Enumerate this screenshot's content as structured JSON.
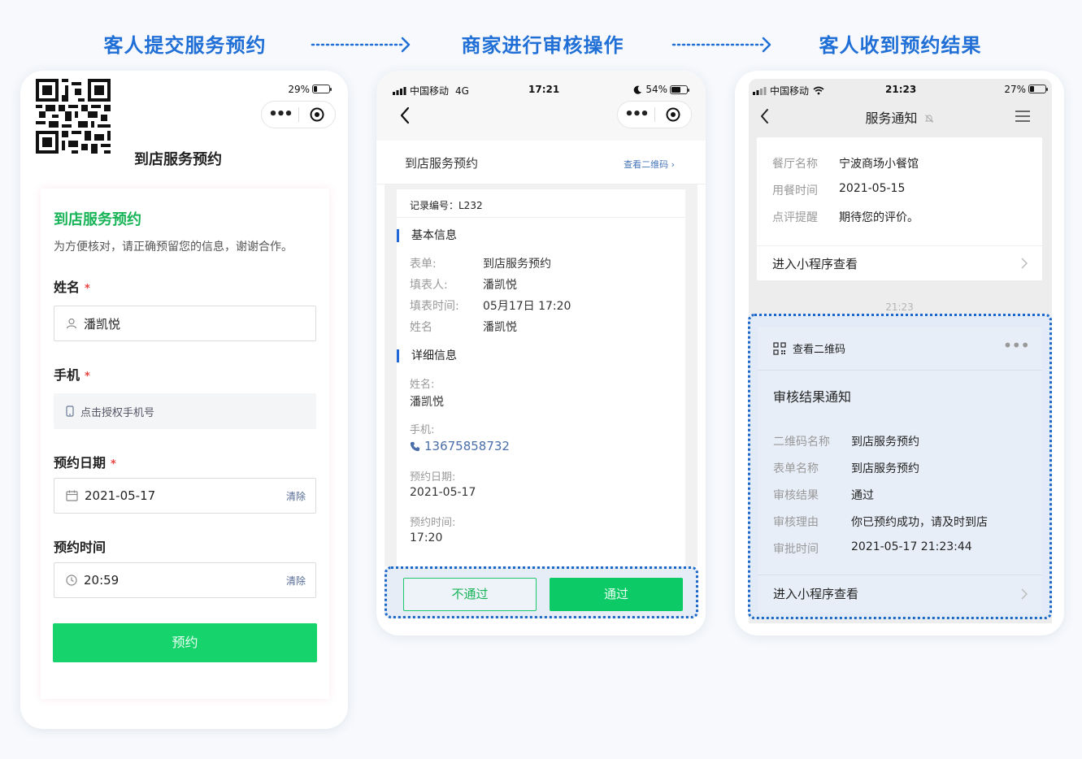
{
  "steps": {
    "step1": "客人提交服务预约",
    "step2": "商家进行审核操作",
    "step3": "客人收到预约结果"
  },
  "phone1": {
    "battery": "29%",
    "page_title": "到店服务预约",
    "form_title": "到店服务预约",
    "form_desc": "为方便核对，请正确预留您的信息，谢谢合作。",
    "name_label": "姓名",
    "name_value": "潘凯悦",
    "mobile_label": "手机",
    "mobile_placeholder": "点击授权手机号",
    "date_label": "预约日期",
    "date_value": "2021-05-17",
    "time_label": "预约时间",
    "time_value": "20:59",
    "clear_label": "清除",
    "required_mark": "*",
    "submit_label": "预约"
  },
  "phone2": {
    "carrier": "中国移动",
    "network": "4G",
    "time": "17:21",
    "battery": "54%",
    "header_title": "到店服务预约",
    "qr_link": "查看二维码",
    "record_no": "记录编号：L232",
    "basic_title": "基本信息",
    "basic": [
      {
        "k": "表单:",
        "v": "到店服务预约"
      },
      {
        "k": "填表人:",
        "v": "潘凯悦"
      },
      {
        "k": "填表时间:",
        "v": "05月17日 17:20"
      },
      {
        "k": "姓名",
        "v": "潘凯悦"
      }
    ],
    "detail_title": "详细信息",
    "details": [
      {
        "k": "姓名:",
        "v": "潘凯悦"
      },
      {
        "k": "手机:",
        "v": "13675858732"
      },
      {
        "k": "预约日期:",
        "v": "2021-05-17"
      },
      {
        "k": "预约时间:",
        "v": "17:20"
      }
    ],
    "reject_label": "不通过",
    "pass_label": "通过"
  },
  "phone3": {
    "carrier": "中国移动",
    "time": "21:23",
    "battery": "27%",
    "title": "服务通知",
    "notice1": [
      {
        "k": "餐厅名称",
        "v": "宁波商场小餐馆"
      },
      {
        "k": "用餐时间",
        "v": "2021-05-15"
      },
      {
        "k": "点评提醒",
        "v": "期待您的评价。"
      }
    ],
    "enter_label": "进入小程序查看",
    "timestamp": "21:23",
    "qr_head": "查看二维码",
    "result_title": "审核结果通知",
    "notice2": [
      {
        "k": "二维码名称",
        "v": "到店服务预约"
      },
      {
        "k": "表单名称",
        "v": "到店服务预约"
      },
      {
        "k": "审核结果",
        "v": "通过"
      },
      {
        "k": "审核理由",
        "v": "你已预约成功，请及时到店"
      },
      {
        "k": "审批时间",
        "v": "2021-05-17 21:23:44"
      }
    ],
    "enter_label2": "进入小程序查看"
  },
  "colors": {
    "step_title": "#1f6fd6",
    "green": "#16d46b",
    "highlight_border": "#1c68c6"
  }
}
